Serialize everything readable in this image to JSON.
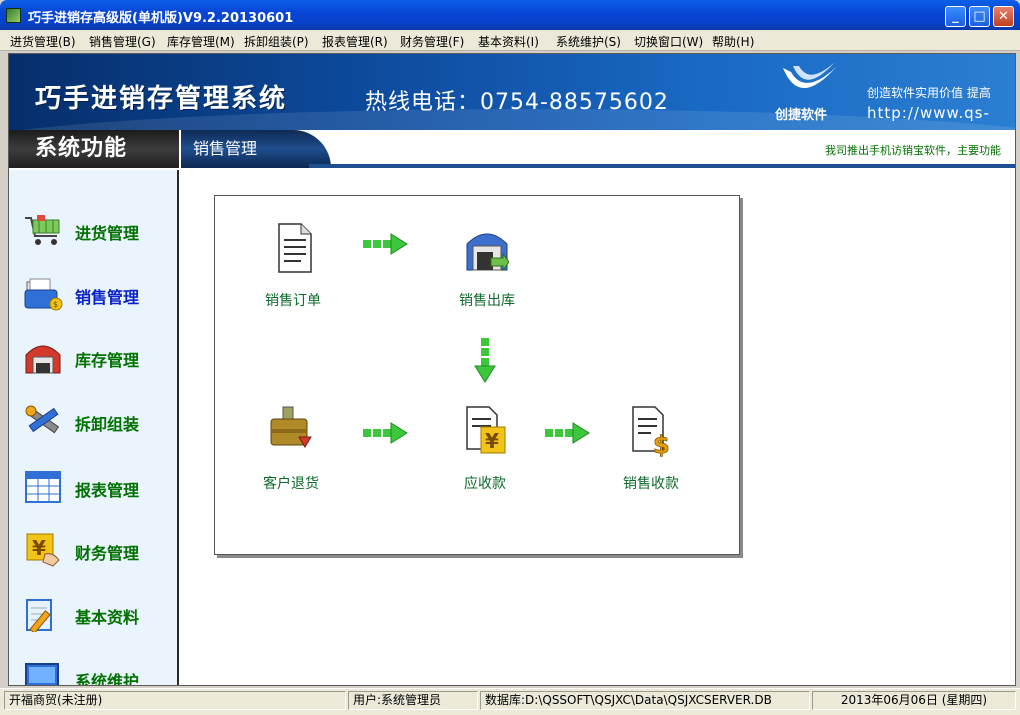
{
  "window": {
    "title": "巧手进销存高级版(单机版)V9.2.20130601",
    "minimize_label": "_",
    "maximize_label": "□",
    "close_label": "✕"
  },
  "menu": {
    "items": [
      {
        "label": "进货管理(B)"
      },
      {
        "label": "销售管理(G)"
      },
      {
        "label": "库存管理(M)"
      },
      {
        "label": "拆卸组装(P)"
      },
      {
        "label": "报表管理(R)"
      },
      {
        "label": "财务管理(F)"
      },
      {
        "label": "基本资料(I)"
      },
      {
        "label": "系统维护(S)"
      },
      {
        "label": "切换窗口(W)"
      },
      {
        "label": "帮助(H)"
      }
    ]
  },
  "banner": {
    "title": "巧手进销存管理系统",
    "hotline": "热线电话：0754-88575602",
    "logo_text": "创捷软件",
    "slogan": "创造软件实用价值  提高",
    "website": "http://www.qs-"
  },
  "subheader": {
    "section_title": "系统功能",
    "current_module": "销售管理",
    "ticker": "我司推出手机访销宝软件，主要功能"
  },
  "sidebar": {
    "items": [
      {
        "label": "进货管理",
        "icon": "shopping-cart-icon"
      },
      {
        "label": "销售管理",
        "icon": "wallet-icon",
        "active": true
      },
      {
        "label": "库存管理",
        "icon": "warehouse-icon"
      },
      {
        "label": "拆卸组装",
        "icon": "tools-icon"
      },
      {
        "label": "报表管理",
        "icon": "table-icon"
      },
      {
        "label": "财务管理",
        "icon": "yen-icon"
      },
      {
        "label": "基本资料",
        "icon": "notepad-pencil-icon"
      },
      {
        "label": "系统维护",
        "icon": "monitor-icon"
      }
    ]
  },
  "flow": {
    "nodes": [
      {
        "label": "销售订单",
        "icon": "document-icon"
      },
      {
        "label": "销售出库",
        "icon": "warehouse-out-icon"
      },
      {
        "label": "客户退货",
        "icon": "briefcase-return-icon"
      },
      {
        "label": "应收款",
        "icon": "receivable-icon"
      },
      {
        "label": "销售收款",
        "icon": "dollar-document-icon"
      }
    ],
    "arrow_color": "#3cc83c"
  },
  "status": {
    "company": "开福商贸(未注册)",
    "user": "用户:系统管理员",
    "database": "数据库:D:\\QSSOFT\\QSJXC\\Data\\QSJXCSERVER.DB",
    "date": "2013年06月06日 (星期四)"
  }
}
